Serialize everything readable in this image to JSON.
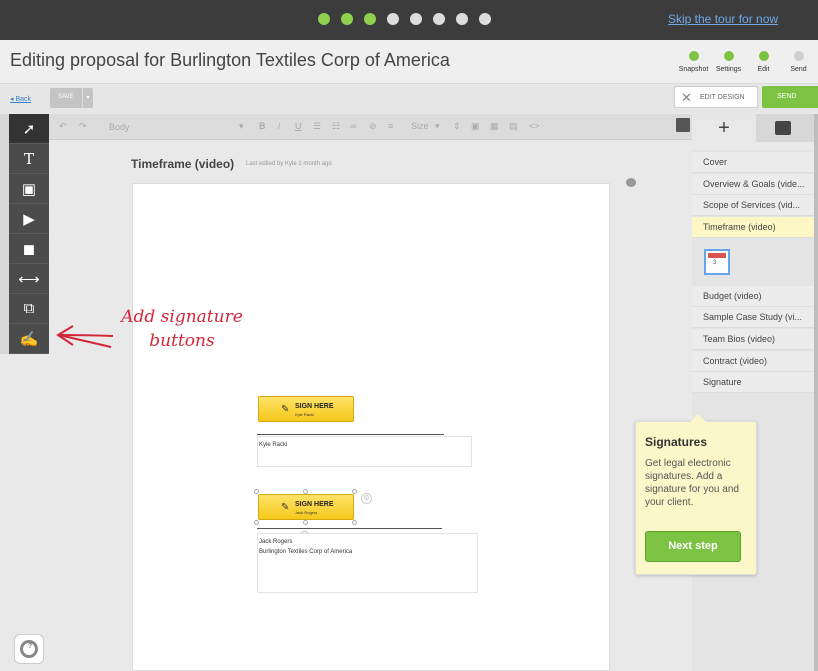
{
  "tour": {
    "dots_total": 8,
    "dots_active": 3,
    "skip_label": "Skip the tour for now"
  },
  "header": {
    "title": "Editing proposal for Burlington Textiles Corp of America",
    "steps": [
      {
        "label": "Snapshot",
        "done": true
      },
      {
        "label": "Settings",
        "done": true
      },
      {
        "label": "Edit",
        "done": true
      },
      {
        "label": "Send",
        "done": false
      }
    ]
  },
  "actions": {
    "back_label": "◂ Back",
    "save_label": "SAVE",
    "edit_design_label": "EDIT DESIGN",
    "send_label": "SEND"
  },
  "toolbar": {
    "style_select": "Body",
    "size_select": "Size"
  },
  "tools": [
    "pointer-icon",
    "text-icon",
    "image-icon",
    "video-icon",
    "shapes-icon",
    "line-icon",
    "embed-icon",
    "signature-icon"
  ],
  "document": {
    "section_title": "Timeframe (video)",
    "last_edited": "Last edited by Kyle 1 month ago",
    "signatures": [
      {
        "button_label": "SIGN HERE",
        "signer": "Kyle Racki",
        "lines": [
          "Kyle Racki"
        ]
      },
      {
        "button_label": "SIGN HERE",
        "signer": "Jack Rogers",
        "lines": [
          "Jack Rogers",
          "Burlington Textiles Corp of America"
        ]
      }
    ]
  },
  "annotation": {
    "text_line1": "Add signature",
    "text_line2": "buttons"
  },
  "sections": [
    {
      "label": "Cover",
      "selected": false
    },
    {
      "label": "Overview & Goals (vide...",
      "selected": false
    },
    {
      "label": "Scope of Services (vid...",
      "selected": false
    },
    {
      "label": "Timeframe (video)",
      "selected": true
    },
    {
      "label": "Budget (video)",
      "selected": false
    },
    {
      "label": "Sample Case Study (vi...",
      "selected": false
    },
    {
      "label": "Team Bios (video)",
      "selected": false
    },
    {
      "label": "Contract (video)",
      "selected": false
    },
    {
      "label": "Signature",
      "selected": false
    }
  ],
  "thumbnail_number": "3",
  "tooltip": {
    "title": "Signatures",
    "body": "Get legal electronic signatures. Add a signature for you and your client.",
    "button_label": "Next step"
  },
  "colors": {
    "accent_green": "#7cc243",
    "annotation_red": "#d3263a",
    "selected_section": "#fdf7c5"
  }
}
